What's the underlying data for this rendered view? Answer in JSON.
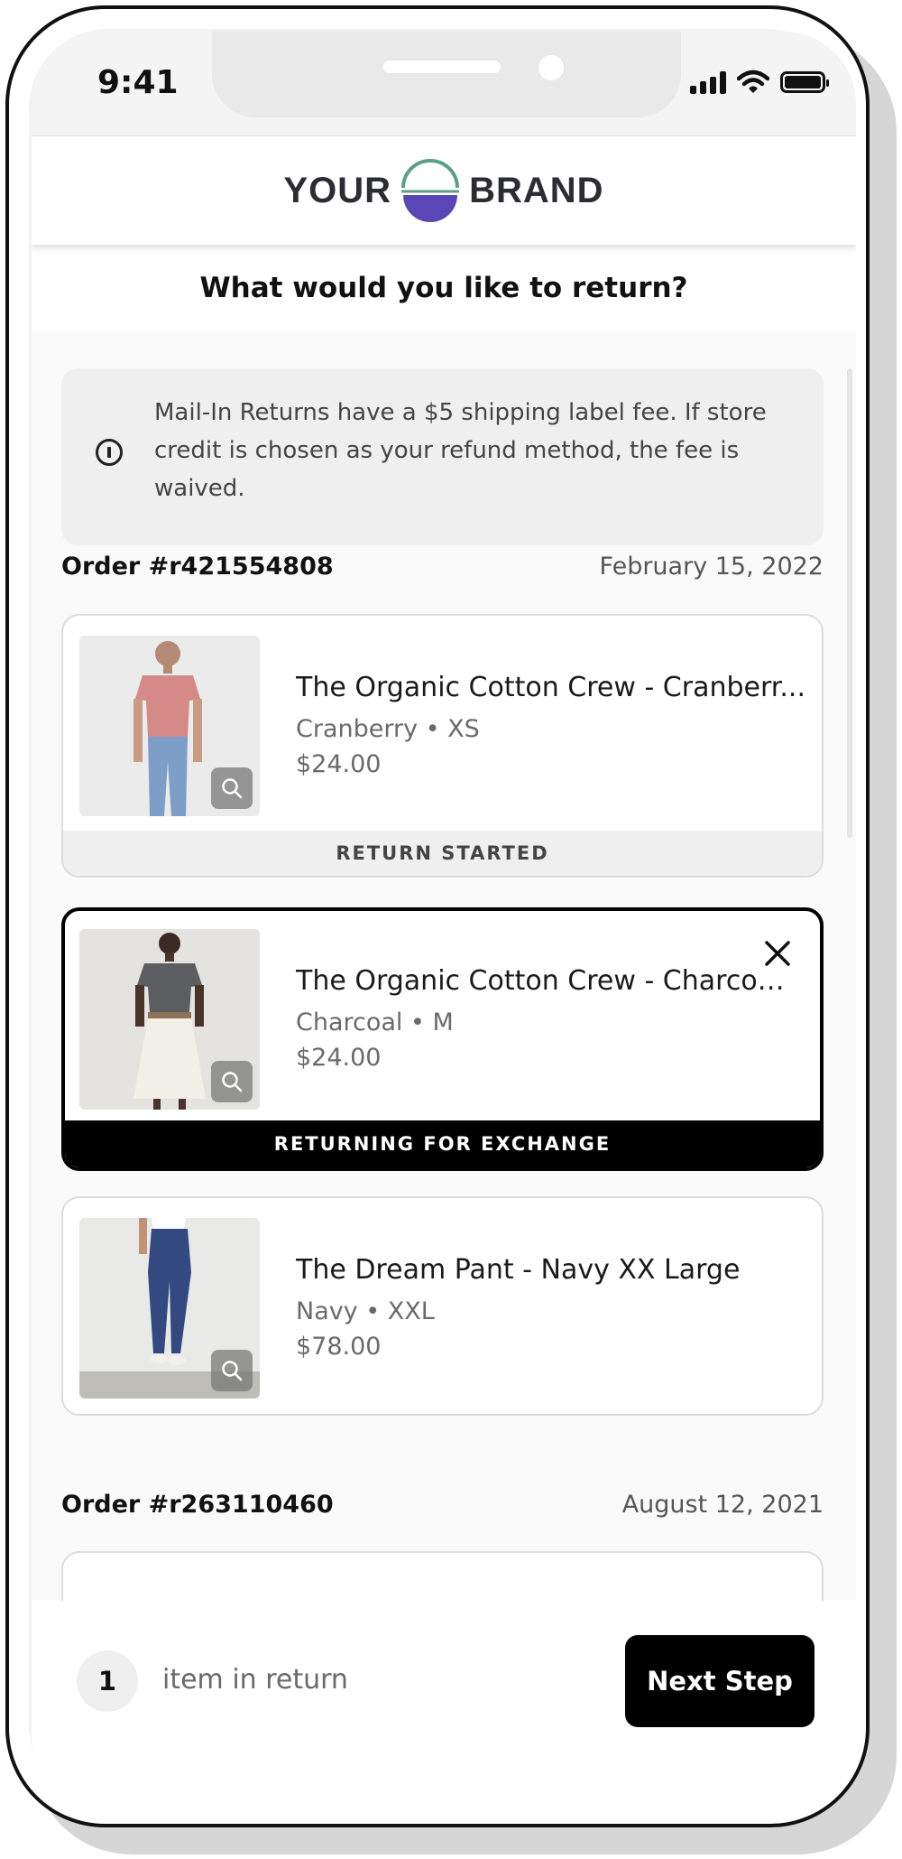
{
  "status_bar": {
    "time": "9:41"
  },
  "brand": {
    "left": "YOUR",
    "right": "BRAND",
    "logo_top_color": "#5e9e86",
    "logo_bottom_color": "#5a47b5"
  },
  "page": {
    "title": "What would you like to return?"
  },
  "notice": {
    "text": "Mail-In Returns have a $5 shipping label fee. If store credit is chosen as your refund method, the fee is waived."
  },
  "orders": [
    {
      "number": "Order #r421554808",
      "date": "February 15, 2022",
      "items": [
        {
          "title": "The Organic Cotton Crew - Cranberr...",
          "variant": "Cranberry • XS",
          "price": "$24.00",
          "status": "RETURN STARTED"
        },
        {
          "title": "The Organic Cotton Crew - Charcoa...",
          "variant": "Charcoal • M",
          "price": "$24.00",
          "status": "RETURNING FOR EXCHANGE",
          "selected": true
        },
        {
          "title": "The Dream Pant - Navy XX Large",
          "variant": "Navy • XXL",
          "price": "$78.00"
        }
      ]
    },
    {
      "number": "Order #r263110460",
      "date": "August 12, 2021"
    }
  ],
  "footer": {
    "count": "1",
    "count_label": "item in return",
    "next_label": "Next Step"
  },
  "colors": {
    "accent": "#000000",
    "notice_bg": "#efefef",
    "muted_text": "#6a6a6a"
  }
}
